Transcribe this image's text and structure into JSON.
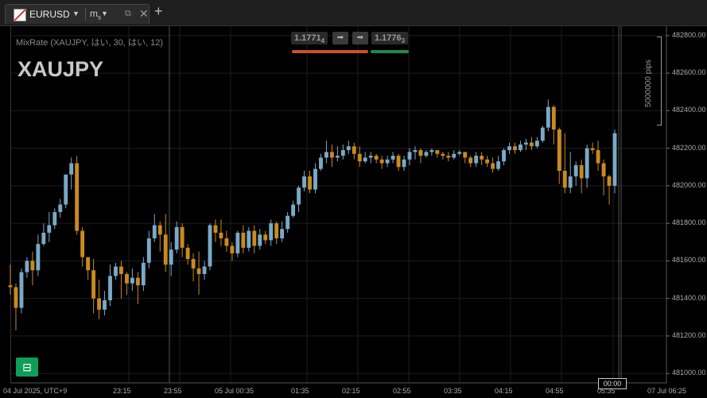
{
  "tab": {
    "symbol": "EURUSD",
    "timeframe_main": "m",
    "timeframe_sub": "s",
    "detach_icon": "⧉",
    "close_icon": "✕",
    "add_icon": "+"
  },
  "chart": {
    "indicator_label": "MixRate (XAUJPY, はい, 30, はい, 12)",
    "symbol_watermark": "XAUJPY",
    "bid": {
      "main": "1.1771",
      "sub": "4"
    },
    "ask": {
      "main": "1.1776",
      "sub": "3"
    },
    "pips_label": "5000000 pips",
    "cursor_time": "00:00",
    "colors": {
      "bull": "#79a9c6",
      "bear": "#c98a20",
      "bid_bar": "#c8502a",
      "ask_bar": "#1e8a4a",
      "grid": "#1e1e1e"
    }
  },
  "chart_data": {
    "type": "candlestick",
    "y_ticks": [
      "482800.00",
      "482600.00",
      "482400.00",
      "482200.00",
      "482000.00",
      "481800.00",
      "481600.00",
      "481400.00",
      "481200.00",
      "481000.00"
    ],
    "x_ticks": [
      "04 Jul 2025, UTC+9",
      "23:15",
      "23:55",
      "05 Jul 00:35",
      "01:35",
      "02:15",
      "02:55",
      "03:35",
      "04:15",
      "04:55",
      "05:35",
      "07 Jul 06:25"
    ],
    "ylim": [
      480950,
      482850
    ],
    "candles": [
      [
        481470,
        481460,
        481420,
        481580
      ],
      [
        481460,
        481350,
        481230,
        481480
      ],
      [
        481350,
        481540,
        481320,
        481560
      ],
      [
        481540,
        481600,
        481510,
        481620
      ],
      [
        481600,
        481550,
        481470,
        481650
      ],
      [
        481550,
        481690,
        481520,
        481740
      ],
      [
        481690,
        481750,
        481680,
        481800
      ],
      [
        481750,
        481790,
        481700,
        481860
      ],
      [
        481790,
        481860,
        481770,
        481880
      ],
      [
        481860,
        481900,
        481830,
        481930
      ],
      [
        481900,
        482060,
        481880,
        482060
      ],
      [
        482060,
        482120,
        481980,
        482150
      ],
      [
        482120,
        481760,
        481740,
        482160
      ],
      [
        481760,
        481620,
        481570,
        481780
      ],
      [
        481620,
        481550,
        481500,
        481580
      ],
      [
        481550,
        481400,
        481320,
        481610
      ],
      [
        481400,
        481340,
        481290,
        481500
      ],
      [
        481340,
        481390,
        481310,
        481440
      ],
      [
        481390,
        481520,
        481360,
        481580
      ],
      [
        481520,
        481570,
        481500,
        481590
      ],
      [
        481570,
        481530,
        481400,
        481600
      ],
      [
        481530,
        481480,
        481420,
        481540
      ],
      [
        481480,
        481510,
        481440,
        481560
      ],
      [
        481510,
        481470,
        481370,
        481540
      ],
      [
        481470,
        481590,
        481440,
        481620
      ],
      [
        481590,
        481720,
        481560,
        481760
      ],
      [
        481720,
        481790,
        481700,
        481850
      ],
      [
        481790,
        481740,
        481650,
        481810
      ],
      [
        481740,
        481580,
        481540,
        481850
      ],
      [
        481580,
        481660,
        481520,
        481700
      ],
      [
        481660,
        481780,
        481640,
        481810
      ],
      [
        481780,
        481670,
        481620,
        481800
      ],
      [
        481670,
        481610,
        481580,
        481690
      ],
      [
        481610,
        481560,
        481490,
        481640
      ],
      [
        481560,
        481530,
        481420,
        481650
      ],
      [
        481530,
        481570,
        481500,
        481600
      ],
      [
        481570,
        481790,
        481550,
        481800
      ],
      [
        481790,
        481750,
        481700,
        481820
      ],
      [
        481750,
        481720,
        481680,
        481820
      ],
      [
        481720,
        481680,
        481650,
        481760
      ],
      [
        481680,
        481640,
        481600,
        481700
      ],
      [
        481640,
        481750,
        481620,
        481760
      ],
      [
        481750,
        481670,
        481640,
        481790
      ],
      [
        481670,
        481760,
        481650,
        481780
      ],
      [
        481760,
        481680,
        481640,
        481790
      ],
      [
        481680,
        481740,
        481660,
        481770
      ],
      [
        481740,
        481710,
        481690,
        481760
      ],
      [
        481710,
        481800,
        481680,
        481820
      ],
      [
        481800,
        481720,
        481690,
        481810
      ],
      [
        481720,
        481770,
        481700,
        481810
      ],
      [
        481770,
        481840,
        481750,
        481860
      ],
      [
        481840,
        481900,
        481830,
        481920
      ],
      [
        481900,
        481990,
        481860,
        482000
      ],
      [
        481990,
        482050,
        481970,
        482080
      ],
      [
        482050,
        481980,
        481960,
        482080
      ],
      [
        481980,
        482090,
        481960,
        482120
      ],
      [
        482090,
        482150,
        482080,
        482170
      ],
      [
        482150,
        482180,
        482120,
        482240
      ],
      [
        482180,
        482150,
        482100,
        482220
      ],
      [
        482150,
        482160,
        482130,
        482210
      ],
      [
        482160,
        482190,
        482140,
        482220
      ],
      [
        482190,
        482210,
        482170,
        482240
      ],
      [
        482210,
        482170,
        482140,
        482230
      ],
      [
        482170,
        482130,
        482100,
        482210
      ],
      [
        482130,
        482150,
        482120,
        482180
      ],
      [
        482150,
        482160,
        482120,
        482180
      ],
      [
        482160,
        482140,
        482120,
        482170
      ],
      [
        482140,
        482120,
        482090,
        482160
      ],
      [
        482120,
        482140,
        482100,
        482160
      ],
      [
        482140,
        482160,
        482120,
        482180
      ],
      [
        482160,
        482100,
        482080,
        482170
      ],
      [
        482100,
        482140,
        482080,
        482160
      ],
      [
        482140,
        482180,
        482110,
        482200
      ],
      [
        482180,
        482190,
        482140,
        482210
      ],
      [
        482190,
        482160,
        482120,
        482200
      ],
      [
        482160,
        482180,
        482150,
        482190
      ],
      [
        482180,
        482190,
        482160,
        482200
      ],
      [
        482190,
        482170,
        482150,
        482190
      ],
      [
        482170,
        482160,
        482140,
        482180
      ],
      [
        482160,
        482150,
        482130,
        482180
      ],
      [
        482150,
        482170,
        482140,
        482190
      ],
      [
        482170,
        482180,
        482160,
        482190
      ],
      [
        482180,
        482150,
        482120,
        482180
      ],
      [
        482150,
        482120,
        482100,
        482160
      ],
      [
        482120,
        482160,
        482100,
        482180
      ],
      [
        482160,
        482140,
        482110,
        482180
      ],
      [
        482140,
        482120,
        482100,
        482160
      ],
      [
        482120,
        482090,
        482070,
        482150
      ],
      [
        482090,
        482130,
        482080,
        482160
      ],
      [
        482130,
        482190,
        482110,
        482200
      ],
      [
        482190,
        482210,
        482170,
        482230
      ],
      [
        482210,
        482190,
        482170,
        482230
      ],
      [
        482190,
        482220,
        482180,
        482240
      ],
      [
        482220,
        482230,
        482190,
        482250
      ],
      [
        482230,
        482210,
        482190,
        482260
      ],
      [
        482210,
        482240,
        482200,
        482260
      ],
      [
        482240,
        482310,
        482230,
        482320
      ],
      [
        482310,
        482420,
        482290,
        482460
      ],
      [
        482420,
        482300,
        482220,
        482430
      ],
      [
        482300,
        482080,
        482010,
        482310
      ],
      [
        482080,
        481990,
        481960,
        482280
      ],
      [
        481990,
        482050,
        481960,
        482180
      ],
      [
        482050,
        482110,
        482000,
        482130
      ],
      [
        482110,
        482040,
        481960,
        482140
      ],
      [
        482040,
        482200,
        481990,
        482220
      ],
      [
        482200,
        482190,
        482170,
        482230
      ],
      [
        482190,
        482120,
        482080,
        482240
      ],
      [
        482120,
        482050,
        481950,
        482140
      ],
      [
        482050,
        482000,
        481900,
        482060
      ],
      [
        482000,
        482280,
        481960,
        482300
      ]
    ]
  }
}
